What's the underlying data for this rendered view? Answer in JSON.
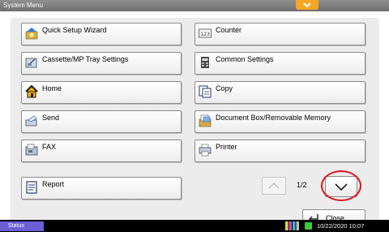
{
  "window": {
    "title": "System Menu"
  },
  "menu": {
    "left": [
      {
        "label": "Quick Setup Wizard",
        "icon": "wizard-icon"
      },
      {
        "label": "Cassette/MP Tray Settings",
        "icon": "tray-icon"
      },
      {
        "label": "Home",
        "icon": "home-icon"
      },
      {
        "label": "Send",
        "icon": "send-icon"
      },
      {
        "label": "FAX",
        "icon": "fax-icon"
      },
      {
        "label": "Report",
        "icon": "report-icon"
      }
    ],
    "right": [
      {
        "label": "Counter",
        "icon": "counter-icon",
        "icon_text": "123"
      },
      {
        "label": "Common Settings",
        "icon": "common-settings-icon"
      },
      {
        "label": "Copy",
        "icon": "copy-icon"
      },
      {
        "label": "Document Box/Removable Memory",
        "icon": "document-box-icon"
      },
      {
        "label": "Printer",
        "icon": "printer-icon"
      }
    ]
  },
  "pager": {
    "text": "1/2"
  },
  "close": {
    "label": "Close"
  },
  "statusbar": {
    "status_label": "Status",
    "datetime": "10/22/2020  10:07"
  },
  "colors": {
    "accent": "#f5a623",
    "status": "#6b5fd6",
    "highlight": "#e0141e"
  }
}
